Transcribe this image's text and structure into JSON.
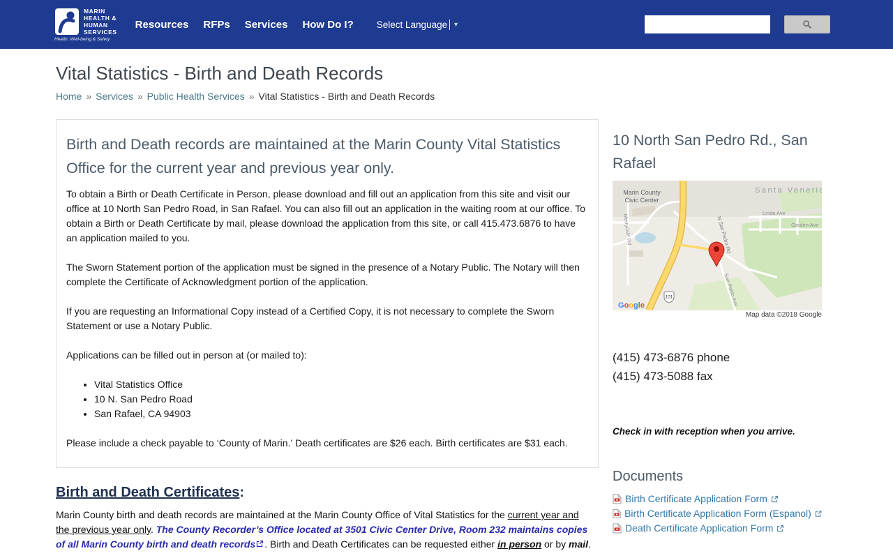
{
  "header": {
    "logo": {
      "org1": "MARIN",
      "org2": "HEALTH &",
      "org3": "HUMAN",
      "org4": "SERVICES",
      "tagline": "Health, Well-being & Safety"
    },
    "nav": {
      "resources": "Resources",
      "rfps": "RFPs",
      "services": "Services",
      "howdoi": "How Do I?"
    },
    "language_label": "Select Language"
  },
  "page": {
    "title": "Vital Statistics - Birth and Death Records",
    "breadcrumb": {
      "home": "Home",
      "services": "Services",
      "phs": "Public Health Services",
      "current": "Vital Statistics - Birth and Death Records",
      "separator": "»"
    }
  },
  "article": {
    "intro_heading": "Birth and Death records are maintained at the Marin County Vital Statistics Office for the current year and previous year only.",
    "p1": "To obtain a Birth or Death Certificate in Person, please download and fill out an application from this site and visit our office at 10 North San Pedro Road, in San Rafael.  You can also fill out an application in the waiting room at our office. To obtain a Birth or Death Certificate by mail, please download the application from this site, or call 415.473.6876 to have an application mailed to you.",
    "p2": "The Sworn Statement portion of the application must be signed in the presence of a Notary Public. The Notary will then complete the Certificate of Acknowledgment portion of the application.",
    "p3": "If you are requesting an Informational Copy instead of a Certified Copy, it is not necessary to complete the Sworn Statement or use a Notary Public.",
    "p4": "Applications can be filled out in person at (or mailed to):",
    "address": [
      "Vital Statistics Office",
      "10 N. San Pedro Road",
      "San Rafael, CA 94903"
    ],
    "fees": "Please include a check payable to ‘County of Marin.’ Death certificates are $26 each. Birth certificates are $31 each.",
    "certificates_heading": "Birth and Death Certificates",
    "certificates_colon": ":",
    "rich": {
      "seg1": "Marin County birth and death records are maintained at the Marin County Office of Vital Statistics for the ",
      "seg2": "current year and the previous year only",
      "seg3": ".  ",
      "seg4": "The County Recorder’s Office located at 3501 Civic Center Drive, Room 232 maintains copies of all Marin County birth and death records",
      "seg5": ".  Birth and Death Certificates can be requested either ",
      "seg6": "in person",
      "seg7": " or by ",
      "seg8": "mail",
      "seg9": "."
    }
  },
  "sidebar": {
    "location_heading": "10 North San Pedro Rd., San Rafael",
    "map": {
      "labels": {
        "civic_center_1": "Marin County",
        "civic_center_2": "Civic Center",
        "santa_venetia": "Santa Venetia",
        "n_san_pedro": "N San Pedro Rd",
        "linda": "Linda Ave",
        "garden": "Garden Ave",
        "merrydale": "Merrydale Rd",
        "san_pablo": "San Pablo Ave",
        "hwy": "101"
      },
      "attribution": "Map data ©2018 Google"
    },
    "phone": "(415) 473-6876 phone",
    "fax": "(415) 473-5088 fax",
    "reception_note": "Check in with reception when you arrive.",
    "documents_heading": "Documents",
    "documents": [
      {
        "label": "Birth Certificate Application Form"
      },
      {
        "label": "Birth Certificate Application Form (Espanol)"
      },
      {
        "label": "Death Certificate Application Form"
      }
    ]
  }
}
